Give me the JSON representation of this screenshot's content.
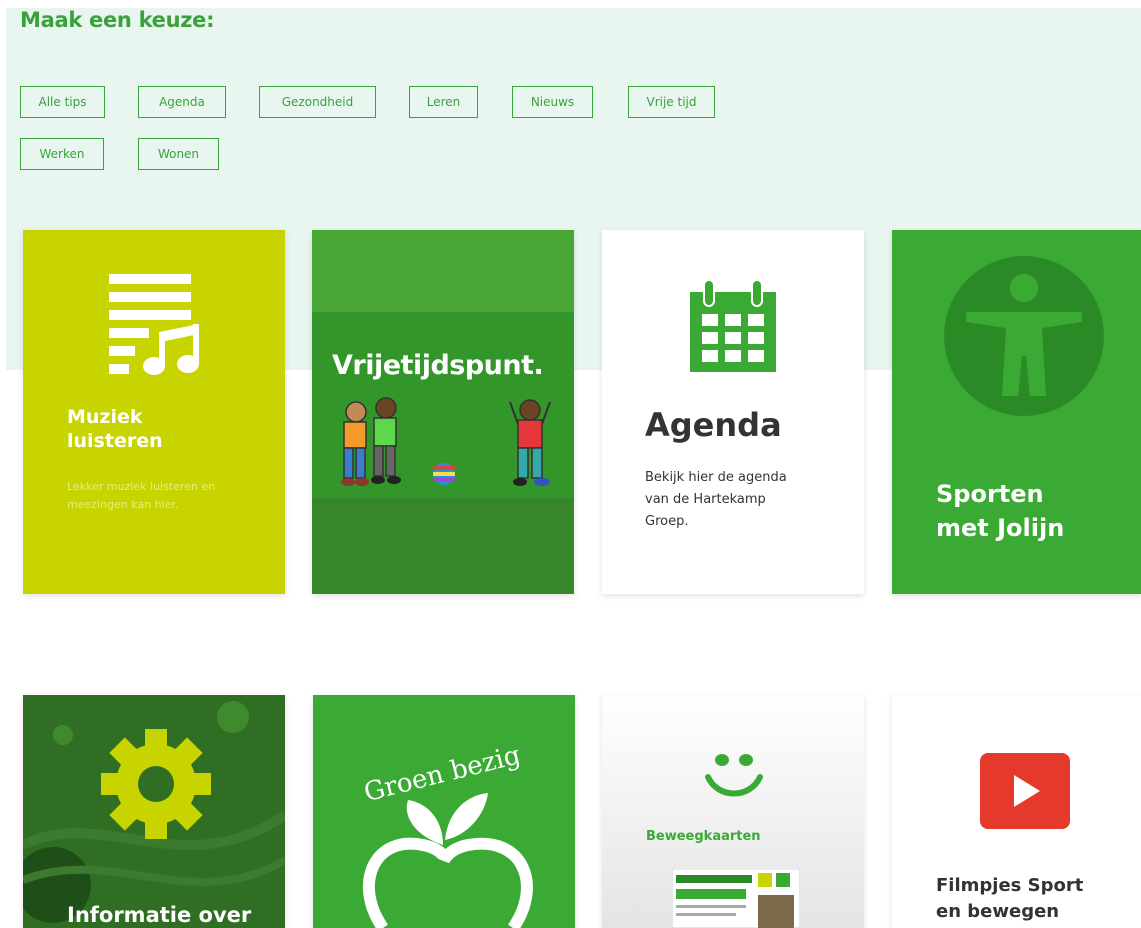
{
  "filter": {
    "heading": "Maak een keuze:",
    "chips": [
      "Alle tips",
      "Agenda",
      "Gezondheid",
      "Leren",
      "Nieuws",
      "Vrije tijd",
      "Werken",
      "Wonen"
    ]
  },
  "cards": [
    {
      "title_line1": "Muziek",
      "title_line2": "luisteren",
      "desc_line1": "Lekker muziek luisteren en",
      "desc_line2": "meezingen kan hier.",
      "color": "#c8d400",
      "icon": "music-list-icon"
    },
    {
      "banner": "Vrijetijdspunt.",
      "color": "#3c9b2c",
      "icon": "children-playing-illustration"
    },
    {
      "title": "Agenda",
      "desc_line1": "Bekijk hier de agenda",
      "desc_line2": "van de Hartekamp",
      "desc_line3": "Groep.",
      "color": "#ffffff",
      "icon": "calendar-icon"
    },
    {
      "title_line1": "Sporten",
      "title_line2": "met Jolijn",
      "color": "#3aaa35",
      "icon": "accessibility-person-icon"
    },
    {
      "title": "Informatie over",
      "color": "#2d6b22",
      "icon": "gear-icon"
    },
    {
      "logo_text": "Groen bezig",
      "color": "#3aaa35",
      "icon": "apple-leaf-icon"
    },
    {
      "title": "Beweegkaarten",
      "color": "#f2f2f2",
      "icon": "smiley-icon"
    },
    {
      "title_line1": "Filmpjes Sport",
      "title_line2": "en bewegen",
      "color": "#ffffff",
      "icon": "play-video-icon"
    }
  ]
}
